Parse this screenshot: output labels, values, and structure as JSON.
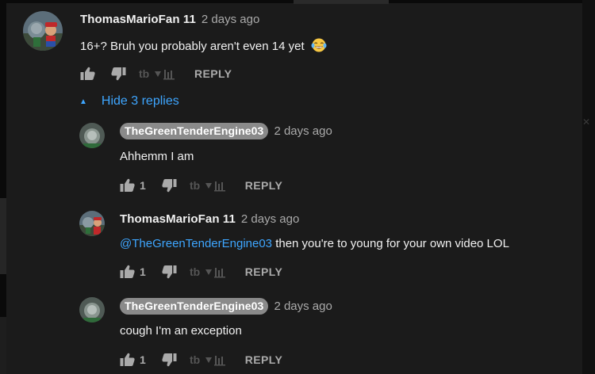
{
  "main_comment": {
    "author": "ThomasMarioFan 11",
    "time": "2 days ago",
    "text": "16+? Bruh you probably aren't even 14 yet",
    "emoji": "face-with-tears-of-joy",
    "like_count": "",
    "reply_label": "REPLY"
  },
  "replies_toggle": {
    "label": "Hide 3 replies"
  },
  "replies": [
    {
      "author": "TheGreenTenderEngine03",
      "author_is_owner": true,
      "time": "2 days ago",
      "text": "Ahhemm I am",
      "like_count": "1",
      "reply_label": "REPLY"
    },
    {
      "author": "ThomasMarioFan 11",
      "author_is_owner": false,
      "time": "2 days ago",
      "mention": "@TheGreenTenderEngine03",
      "text": " then you're to young for your own video LOL",
      "like_count": "1",
      "reply_label": "REPLY"
    },
    {
      "author": "TheGreenTenderEngine03",
      "author_is_owner": true,
      "time": "2 days ago",
      "text": "cough I'm an exception",
      "like_count": "1",
      "reply_label": "REPLY"
    }
  ],
  "colors": {
    "background": "#1b1b1b",
    "link": "#3ea6ff",
    "muted": "#aaaaaa",
    "owner_pill": "#8a8a8a"
  }
}
